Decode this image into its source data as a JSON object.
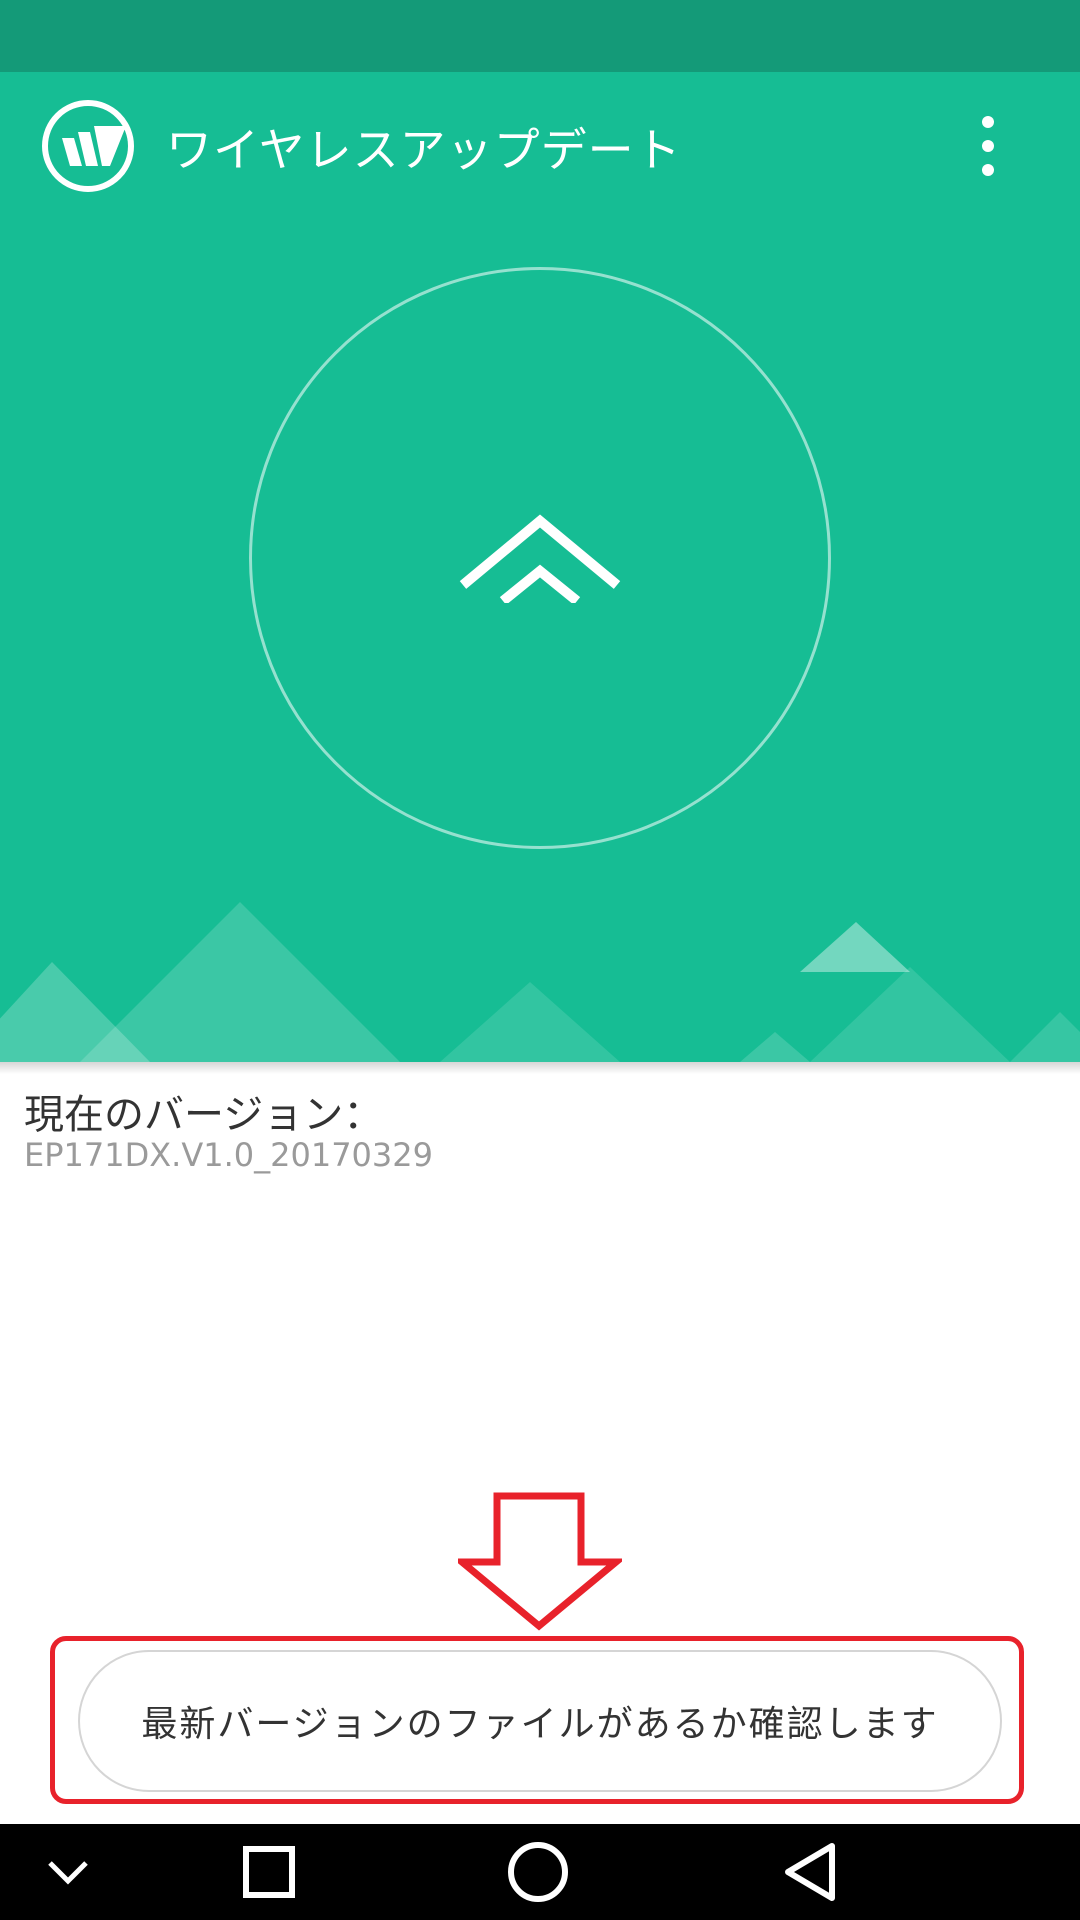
{
  "app": {
    "title": "ワイヤレスアップデート",
    "logo_icon": "wireless-update-logo-icon",
    "menu_icon": "more-vertical-icon"
  },
  "hero": {
    "background_color": "#16bd94",
    "status_bar_color": "#149a78",
    "update_icon": "double-chevron-up-icon"
  },
  "version": {
    "label": "現在のバージョン：",
    "value": "EP171DX.V1.0_20170329"
  },
  "annotation": {
    "color": "#e8222b",
    "arrow_icon": "down-arrow-outline-icon"
  },
  "check_button": {
    "label": "最新バージョンのファイルがあるか確認します"
  },
  "navigation": {
    "items": [
      {
        "icon": "chevron-down-icon"
      },
      {
        "icon": "square-recents-icon"
      },
      {
        "icon": "circle-home-icon"
      },
      {
        "icon": "triangle-back-icon"
      }
    ]
  }
}
